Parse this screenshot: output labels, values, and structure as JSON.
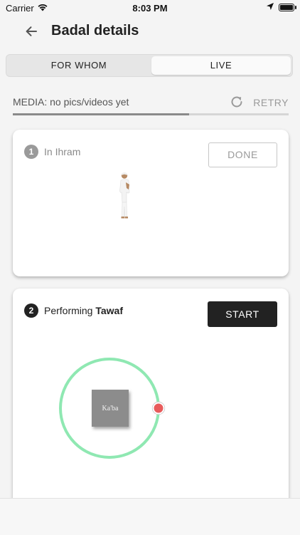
{
  "status_bar": {
    "carrier": "Carrier",
    "time": "8:03 PM"
  },
  "header": {
    "title": "Badal details",
    "back_icon": "arrow-left-icon"
  },
  "tabs": [
    {
      "label": "FOR WHOM",
      "selected": false
    },
    {
      "label": "LIVE",
      "selected": true
    }
  ],
  "media": {
    "status_text": "MEDIA: no pics/videos yet",
    "retry_label": "RETRY",
    "retry_icon": "refresh-icon",
    "progress_fraction": 0.64
  },
  "steps": [
    {
      "number": "1",
      "title": "In Ihram",
      "action_label": "DONE",
      "state": "completed"
    },
    {
      "number": "2",
      "title_prefix": "Performing ",
      "title_bold": "Tawaf",
      "action_label": "START",
      "state": "current",
      "kaaba_label": "Ka'ba"
    }
  ],
  "colors": {
    "accent_dark": "#222222",
    "muted": "#9a9a9a",
    "orbit_green": "#8fe8b2",
    "marker_red": "#e85c5c"
  }
}
